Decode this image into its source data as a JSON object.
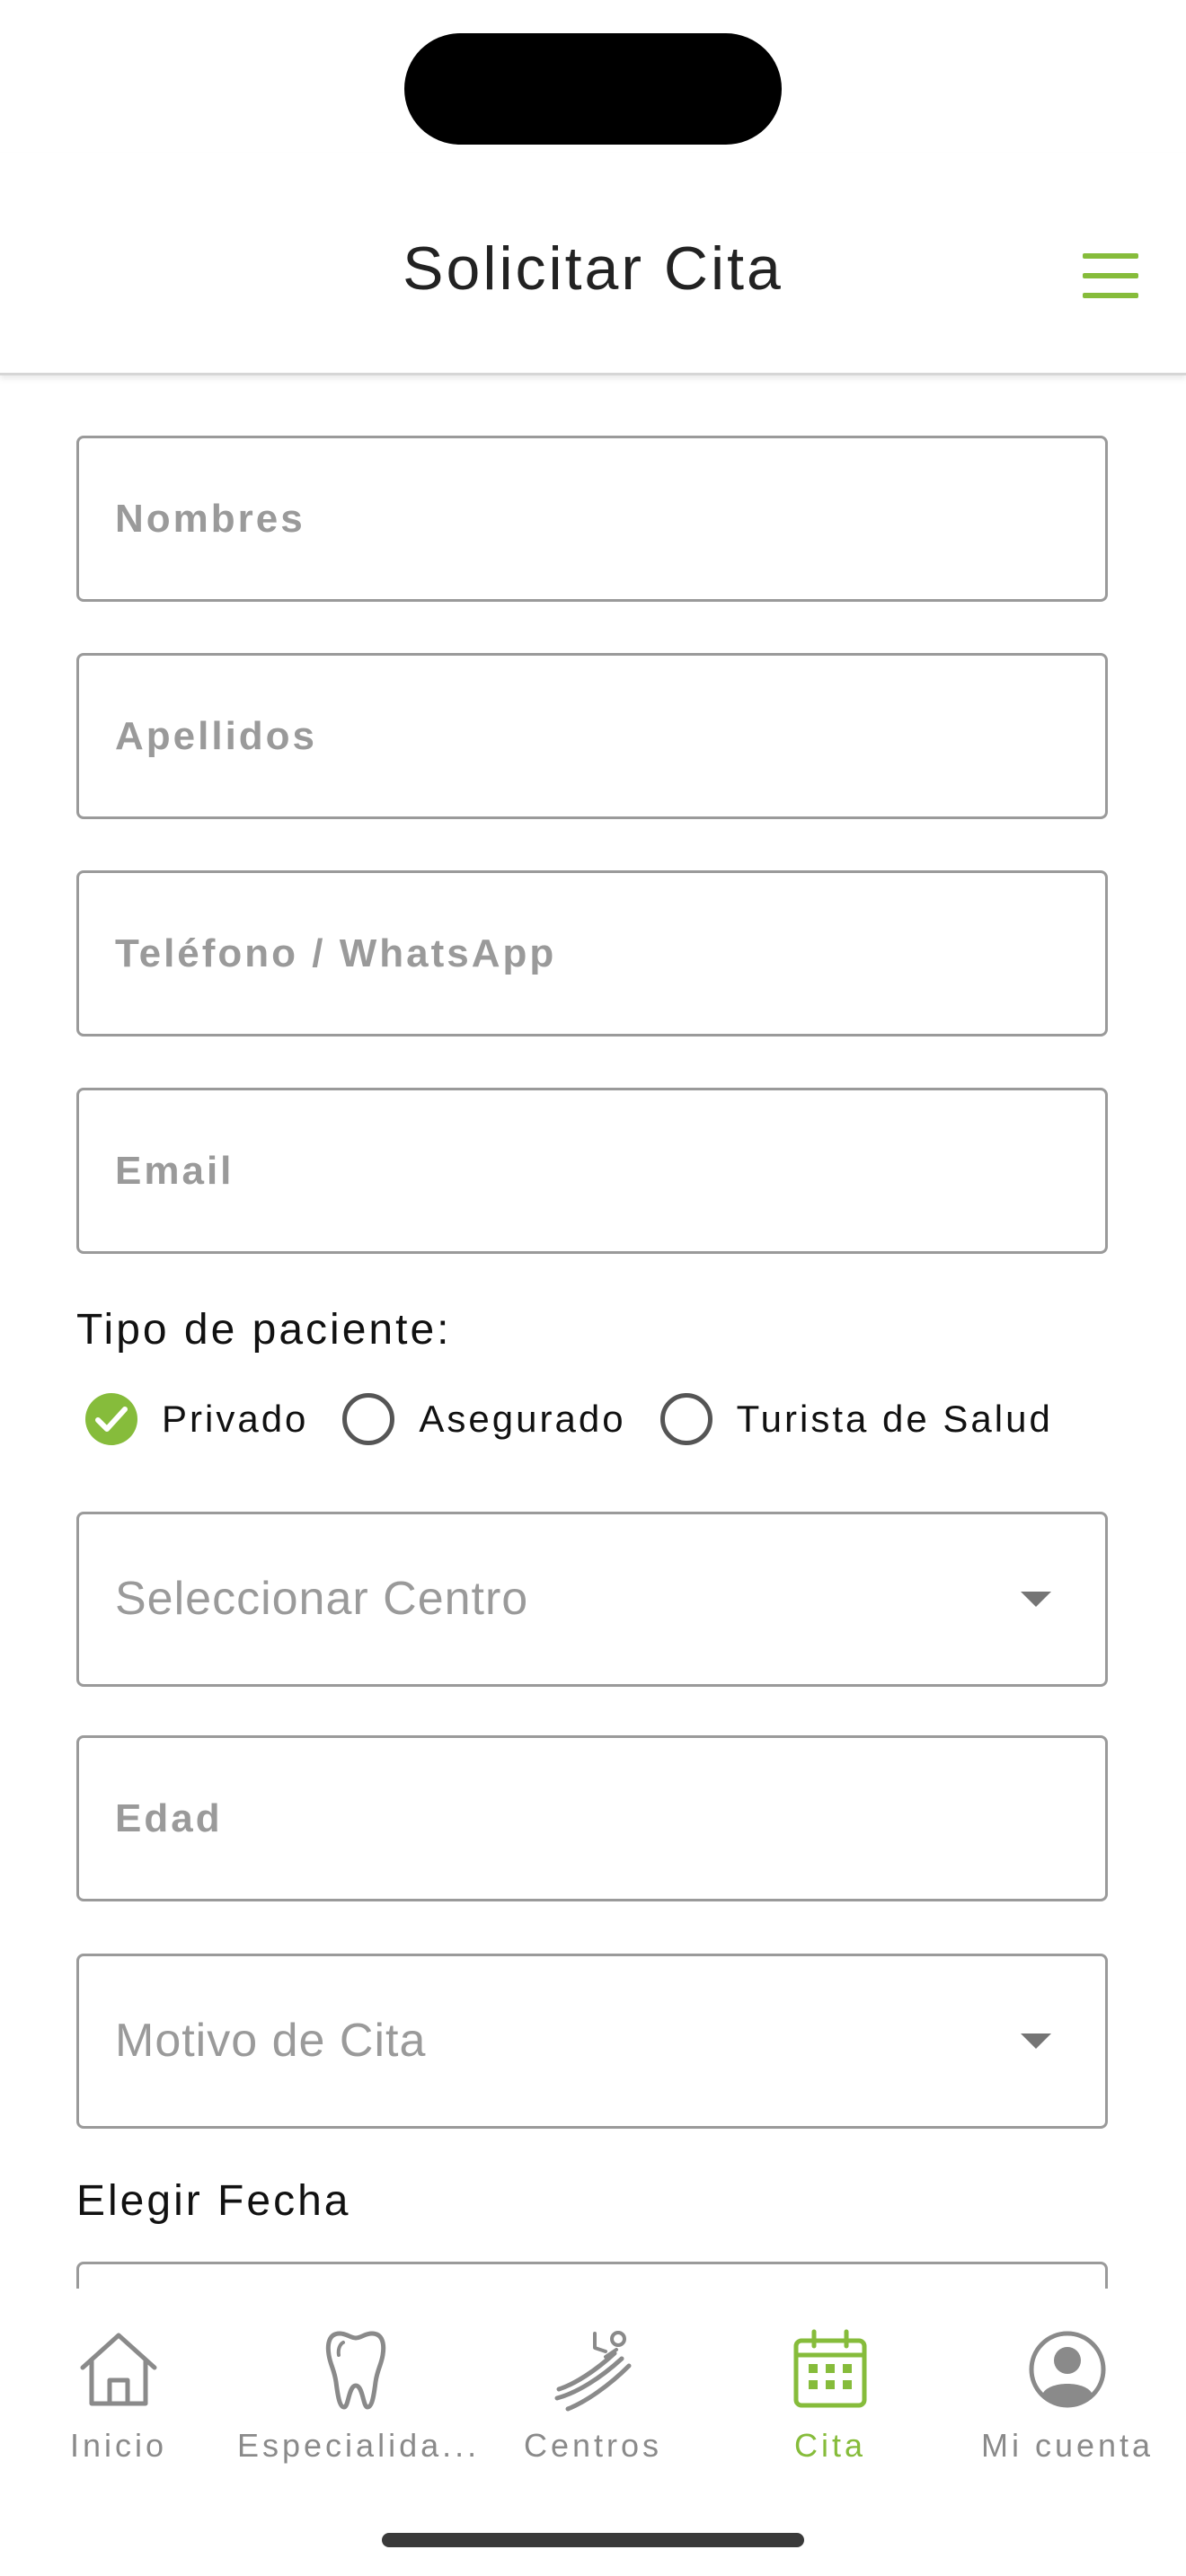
{
  "header": {
    "title": "Solicitar Cita"
  },
  "form": {
    "nombres_placeholder": "Nombres",
    "apellidos_placeholder": "Apellidos",
    "telefono_placeholder": "Teléfono / WhatsApp",
    "email_placeholder": "Email",
    "tipo_paciente_label": "Tipo de paciente:",
    "tipo_paciente_options": [
      "Privado",
      "Asegurado",
      "Turista de Salud"
    ],
    "tipo_paciente_selected": "Privado",
    "centro_placeholder": "Seleccionar Centro",
    "edad_placeholder": "Edad",
    "motivo_placeholder": "Motivo de Cita",
    "fecha_label": "Elegir Fecha"
  },
  "tabbar": {
    "items": [
      {
        "label": "Inicio",
        "icon": "home-icon"
      },
      {
        "label": "Especialida...",
        "icon": "tooth-icon"
      },
      {
        "label": "Centros",
        "icon": "dental-chair-icon"
      },
      {
        "label": "Cita",
        "icon": "calendar-icon"
      },
      {
        "label": "Mi cuenta",
        "icon": "user-circle-icon"
      }
    ],
    "active": "Cita"
  },
  "colors": {
    "accent": "#86bc3b",
    "inactive": "#8a8a8a",
    "border": "#9a9a9a"
  }
}
